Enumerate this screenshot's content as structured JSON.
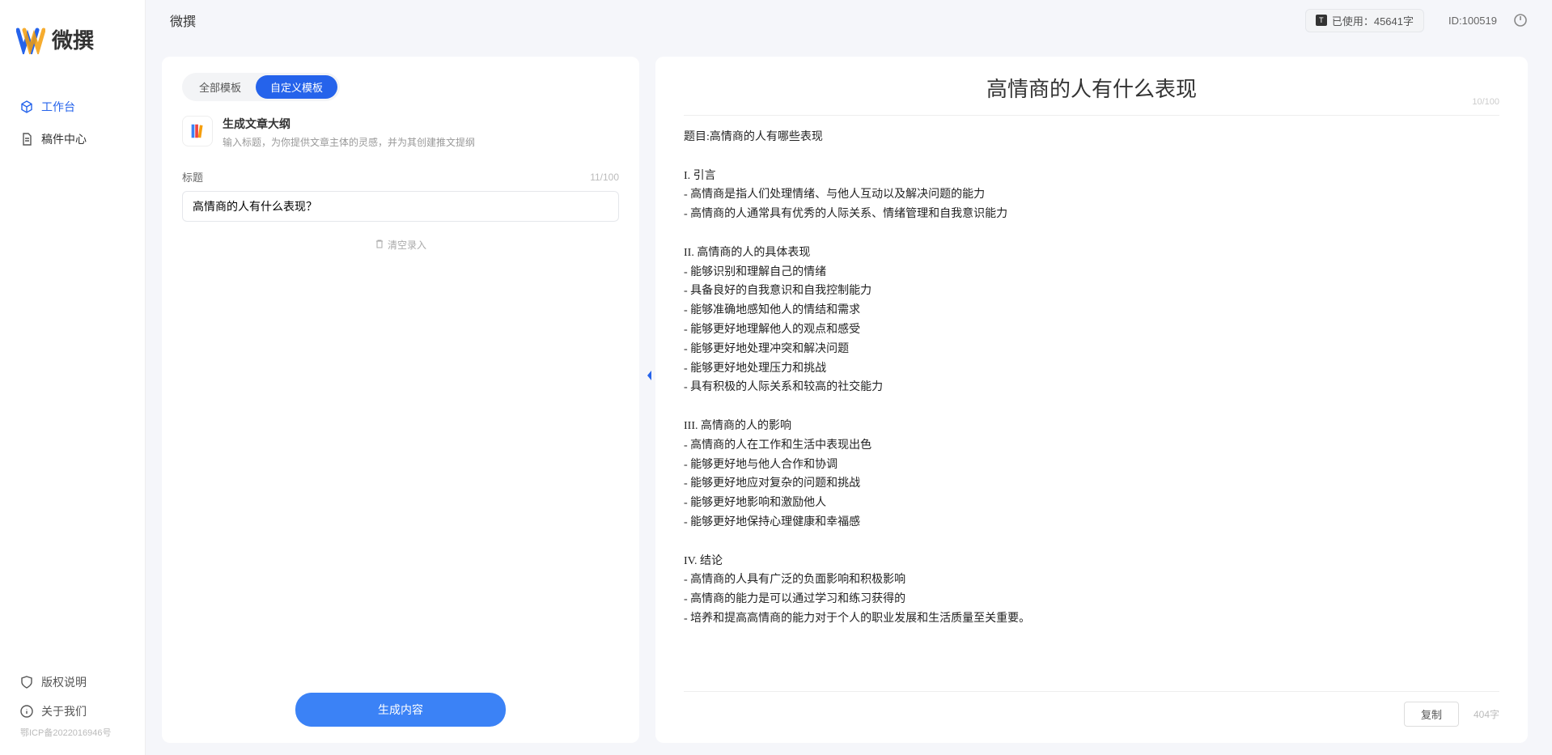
{
  "brand": {
    "name": "微撰"
  },
  "nav": {
    "items": [
      {
        "label": "工作台",
        "active": true
      },
      {
        "label": "稿件中心",
        "active": false
      }
    ]
  },
  "footer_nav": {
    "items": [
      {
        "label": "版权说明"
      },
      {
        "label": "关于我们"
      }
    ]
  },
  "icp": "鄂ICP备2022016946号",
  "topbar": {
    "title": "微撰",
    "usage_label": "已使用：45641字",
    "user_id": "ID:100519"
  },
  "tabs": {
    "items": [
      {
        "label": "全部模板",
        "active": false
      },
      {
        "label": "自定义模板",
        "active": true
      }
    ]
  },
  "template": {
    "title": "生成文章大纲",
    "desc": "输入标题，为你提供文章主体的灵感，并为其创建推文提纲"
  },
  "title_field": {
    "label": "标题",
    "count": "11/100",
    "value": "高情商的人有什么表现？"
  },
  "buttons": {
    "clear": "清空录入",
    "generate": "生成内容",
    "copy": "复制"
  },
  "output": {
    "title": "高情商的人有什么表现",
    "title_count": "10/100",
    "word_count": "404字",
    "body": "题目:高情商的人有哪些表现\n\nI. 引言\n- 高情商是指人们处理情绪、与他人互动以及解决问题的能力\n- 高情商的人通常具有优秀的人际关系、情绪管理和自我意识能力\n\nII. 高情商的人的具体表现\n- 能够识别和理解自己的情绪\n- 具备良好的自我意识和自我控制能力\n- 能够准确地感知他人的情结和需求\n- 能够更好地理解他人的观点和感受\n- 能够更好地处理冲突和解决问题\n- 能够更好地处理压力和挑战\n- 具有积极的人际关系和较高的社交能力\n\nIII. 高情商的人的影响\n- 高情商的人在工作和生活中表现出色\n- 能够更好地与他人合作和协调\n- 能够更好地应对复杂的问题和挑战\n- 能够更好地影响和激励他人\n- 能够更好地保持心理健康和幸福感\n\nIV. 结论\n- 高情商的人具有广泛的负面影响和积极影响\n- 高情商的能力是可以通过学习和练习获得的\n- 培养和提高高情商的能力对于个人的职业发展和生活质量至关重要。"
  }
}
